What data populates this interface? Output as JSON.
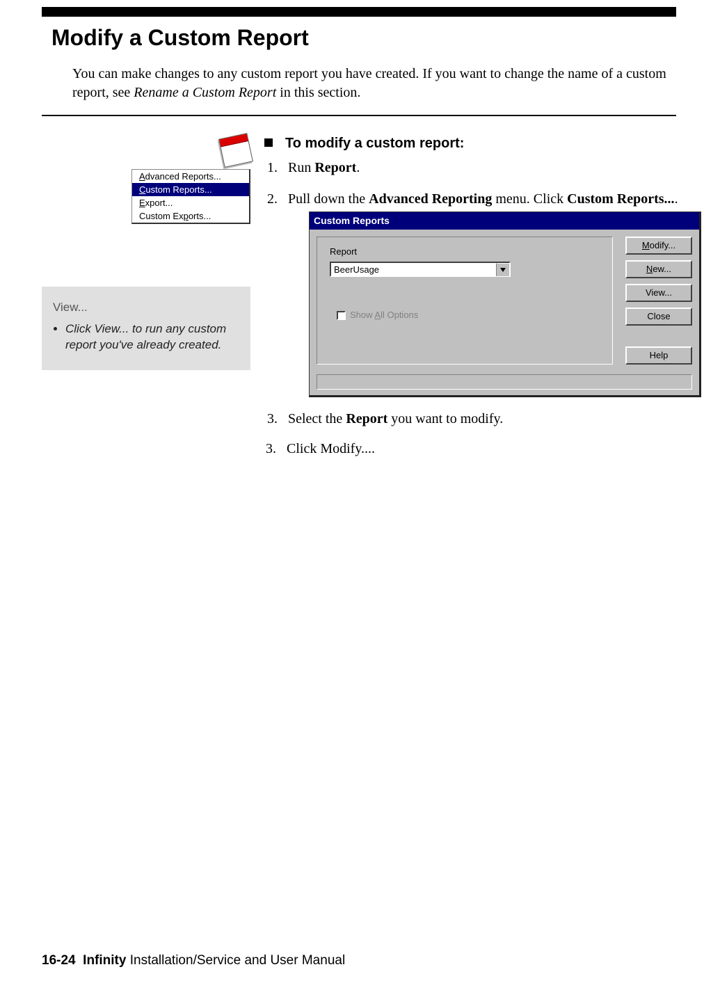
{
  "title": "Modify a Custom Report",
  "intro": {
    "pre": "You can make changes to any custom report you have created. If you want to change the name of a custom report, see ",
    "link": "Rename a Custom Report",
    "post": " in this section."
  },
  "menu": {
    "items": [
      {
        "pre": "",
        "accel": "A",
        "post": "dvanced Reports..."
      },
      {
        "pre": "",
        "accel": "C",
        "post": "ustom Reports..."
      },
      {
        "pre": "",
        "accel": "E",
        "post": "xport..."
      },
      {
        "pre": "Custom Ex",
        "accel": "p",
        "post": "orts..."
      }
    ]
  },
  "tip": {
    "title": "View...",
    "text": "Click View... to run any custom report you've already created."
  },
  "procedure": {
    "heading": "To modify a custom report:",
    "step1": {
      "pre": "Run ",
      "bold": "Report",
      "post": "."
    },
    "step2": {
      "pre": "Pull down the ",
      "bold1": "Advanced Reporting",
      "mid": " menu. Click ",
      "bold2": "Custom Reports...",
      "post": "."
    },
    "step3": {
      "pre": "Select the ",
      "bold": "Report",
      "post": " you want to modify."
    },
    "step4": {
      "num": "3.",
      "pre": "Click ",
      "bold": "Modify...",
      "post": "."
    }
  },
  "dialog": {
    "title": "Custom Reports",
    "reportLabel": "Report",
    "reportValue": "BeerUsage",
    "showAll": {
      "pre": "Show ",
      "accel": "A",
      "post": "ll Options"
    },
    "buttons": {
      "modify": {
        "accel": "M",
        "post": "odify..."
      },
      "new": {
        "accel": "N",
        "post": "ew..."
      },
      "view": {
        "label": "View..."
      },
      "close": {
        "label": "Close"
      },
      "help": {
        "label": "Help"
      }
    }
  },
  "footer": {
    "page": "16-24",
    "brand": "Infinity",
    "rest": " Installation/Service and User Manual"
  }
}
